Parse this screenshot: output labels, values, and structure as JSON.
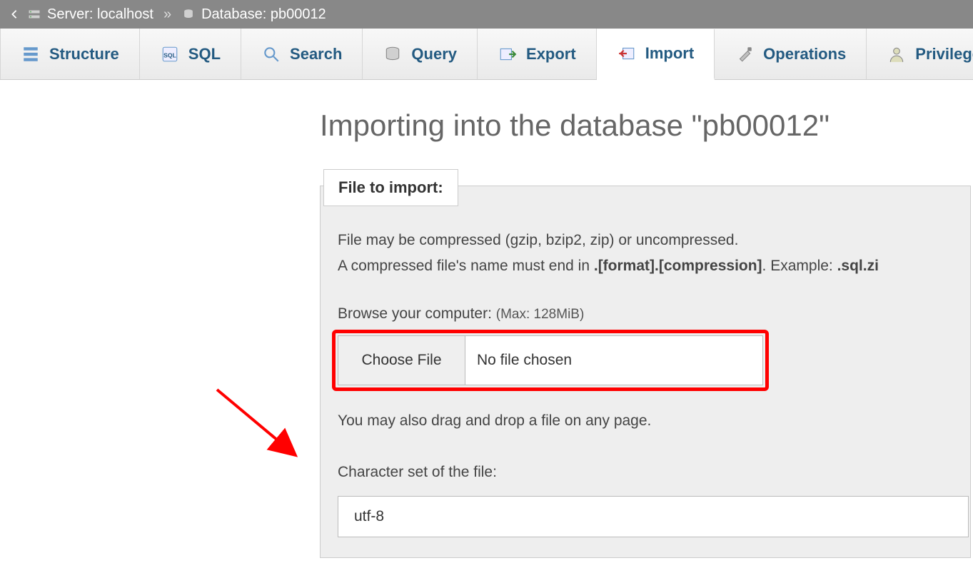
{
  "breadcrumb": {
    "server_label": "Server: localhost",
    "database_label": "Database: pb00012",
    "separator": "»"
  },
  "tabs": [
    {
      "id": "structure",
      "label": "Structure",
      "icon": "structure-icon"
    },
    {
      "id": "sql",
      "label": "SQL",
      "icon": "sql-icon"
    },
    {
      "id": "search",
      "label": "Search",
      "icon": "search-icon"
    },
    {
      "id": "query",
      "label": "Query",
      "icon": "query-icon"
    },
    {
      "id": "export",
      "label": "Export",
      "icon": "export-icon"
    },
    {
      "id": "import",
      "label": "Import",
      "icon": "import-icon",
      "active": true
    },
    {
      "id": "operations",
      "label": "Operations",
      "icon": "operations-icon"
    },
    {
      "id": "privileges",
      "label": "Privilege",
      "icon": "privileges-icon"
    }
  ],
  "main": {
    "title": "Importing into the database \"pb00012\"",
    "legend": "File to import:",
    "hint_line1": "File may be compressed (gzip, bzip2, zip) or uncompressed.",
    "hint_line2_a": "A compressed file's name must end in ",
    "hint_line2_b": ".[format].[compression]",
    "hint_line2_c": ". Example: ",
    "hint_line2_d": ".sql.zi",
    "browse_label": "Browse your computer: ",
    "browse_max": "(Max: 128MiB)",
    "choose_file_btn": "Choose File",
    "no_file_chosen": "No file chosen",
    "dragdrop": "You may also drag and drop a file on any page.",
    "charset_label": "Character set of the file:",
    "charset_value": "utf-8"
  },
  "annotation": {
    "arrow_color": "#ff0000"
  }
}
